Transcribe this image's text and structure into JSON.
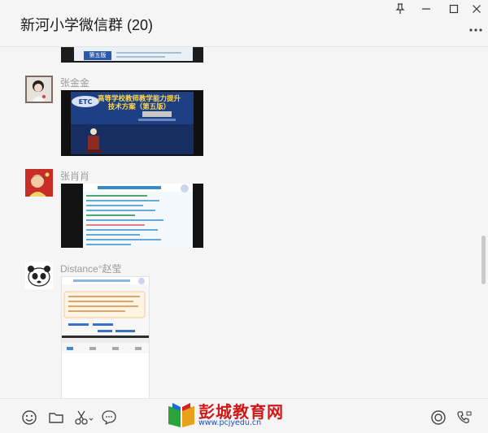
{
  "header": {
    "title": "新河小学微信群 (20)"
  },
  "messages": [
    {
      "sender": "张金金",
      "content_type": "video"
    },
    {
      "sender": "张肖肖",
      "content_type": "image"
    },
    {
      "sender": "Distance°赵莹",
      "content_type": "image"
    }
  ],
  "slides": {
    "partial_badge": "第五版",
    "video_title_line1": "高等学校教师教学能力提升",
    "video_title_line2": "技术方案（第五版）"
  },
  "toolbar": {
    "icons": [
      "emoji-icon",
      "folder-icon",
      "scissors-icon",
      "chat-bubble-icon",
      "voice-call-icon",
      "video-call-icon"
    ]
  },
  "watermark": {
    "name": "彭城教育网",
    "url": "www.pcjyedu.cn"
  },
  "colors": {
    "background": "#f5f5f5",
    "watermark_red": "#d01818",
    "watermark_blue": "#1b4fb8"
  }
}
